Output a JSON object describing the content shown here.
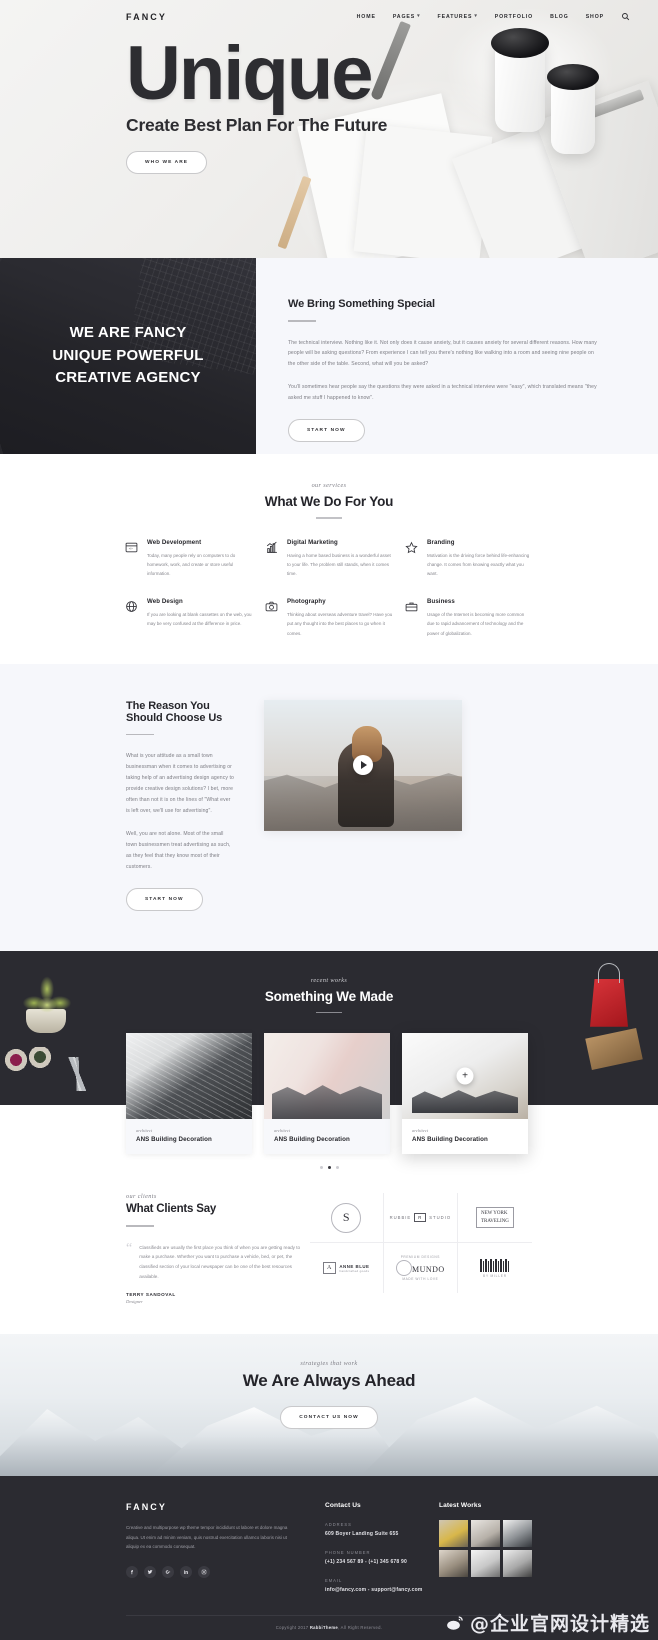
{
  "header": {
    "brand": "FANCY",
    "nav": [
      {
        "label": "HOME",
        "caret": false
      },
      {
        "label": "PAGES",
        "caret": true
      },
      {
        "label": "FEATURES",
        "caret": true
      },
      {
        "label": "PORTFOLIO",
        "caret": false
      },
      {
        "label": "BLOG",
        "caret": false
      },
      {
        "label": "SHOP",
        "caret": false
      }
    ],
    "search_icon": "search-icon"
  },
  "hero": {
    "title": "Unique",
    "subtitle": "Create Best Plan For The Future",
    "cta": "WHO WE ARE"
  },
  "about": {
    "left_heading": "WE ARE FANCY\nUNIQUE POWERFUL\nCREATIVE AGENCY",
    "title": "We Bring Something Special",
    "paragraph1": "The technical interview. Nothing like it. Not only does it cause anxiety, but it causes anxiety for several different reasons. How many people will be asking questions? From experience I can tell you there's nothing like walking into a room and seeing nine people on the other side of the table. Second, what will you be asked?",
    "paragraph2": "You'll sometimes hear people say the questions they were asked in a technical interview were \"easy\", which translated means \"they asked me stuff I happened to know\".",
    "cta": "START NOW"
  },
  "services": {
    "eyebrow": "our services",
    "title": "What We Do For You",
    "items": [
      {
        "icon": "browser-icon",
        "title": "Web Development",
        "text": "Today, many people rely on computers to do homework, work, and create or store useful information."
      },
      {
        "icon": "chart-bars-icon",
        "title": "Digital Marketing",
        "text": "Having a home based business is a wonderful asset to your life. The problem still stands, when it comes time."
      },
      {
        "icon": "star-icon",
        "title": "Branding",
        "text": "Motivation is the driving force behind life-enhancing change. It comes from knowing exactly what you want."
      },
      {
        "icon": "globe-icon",
        "title": "Web Design",
        "text": "If you are looking at blank cassettes on the web, you may be very confused at the difference in price."
      },
      {
        "icon": "camera-icon",
        "title": "Photography",
        "text": "Thinking about overseas adventure travel? Have you put any thought into the best places to go when it comes."
      },
      {
        "icon": "briefcase-icon",
        "title": "Business",
        "text": "Usage of the Internet is becoming more common due to rapid advancement of technology and the power of globalization."
      }
    ]
  },
  "choose": {
    "title": "The Reason You Should Choose Us",
    "paragraph1": "What is your attitude as a small town businessman when it comes to advertising or taking help of an advertising design agency to provide creative design solutions? I bet, more often than not it is on the lines of \"What ever is left over, we'll use for advertising\".",
    "paragraph2": "Well, you are not alone. Most of the small town businessmen treat advertising as such, as they feel that they know most of their customers.",
    "cta": "START NOW",
    "video_play": "play-icon"
  },
  "works": {
    "eyebrow": "recent works",
    "title": "Something We Made",
    "cards": [
      {
        "category": "architect",
        "title": "ANS Building Decoration"
      },
      {
        "category": "architect",
        "title": "ANS Building Decoration"
      },
      {
        "category": "architect",
        "title": "ANS Building Decoration"
      }
    ],
    "dots": [
      false,
      true,
      false
    ]
  },
  "clients": {
    "eyebrow": "our clients",
    "title": "What Clients Say",
    "quote": "Classifieds are usually the first place you think of when you are getting ready to make a purchase. Whether you want to purchase a vehicle, bed, or pet, the classified section of your local newspaper can be one of the best resources available.",
    "author": "TERRY SANDOVAL",
    "role": "Designer",
    "logos": [
      {
        "name": "seal-logo",
        "main": "S"
      },
      {
        "name": "studio-logo",
        "left": "RUBBIE",
        "mid": "R",
        "right": "STUDIO"
      },
      {
        "name": "new-york-traveling-logo",
        "line1": "NEW YORK",
        "line2": "TRAVELING"
      },
      {
        "name": "anne-blue-logo",
        "mark": "A",
        "main": "ANNE BLUE",
        "sub": "handcrafted goods"
      },
      {
        "name": "mundo-logo",
        "top": "PREMIUM DESIGNS",
        "main": "MUNDO",
        "sub": "MADE WITH LOVE"
      },
      {
        "name": "barcode-logo",
        "caption": "BY MILLER"
      }
    ]
  },
  "ahead": {
    "eyebrow": "strategies that work",
    "title": "We Are Always Ahead",
    "cta": "CONTACT US NOW"
  },
  "footer": {
    "brand": "FANCY",
    "about": "Creative and multipurpose wp theme tempor incididunt ut labore et dolore magna aliqua. Ut enim ad minim veniam, quis nostrud exercitation ullamco laboris nisi ut aliquip ex ea commodo consequat.",
    "socials": [
      "facebook-icon",
      "twitter-icon",
      "google-plus-icon",
      "linkedin-icon",
      "instagram-icon"
    ],
    "contact_heading": "Contact Us",
    "address_label": "ADDRESS",
    "address_value": "609 Boyer Landing Suite 655",
    "phone_label": "PHONE NUMBER",
    "phone_value": "(+1) 234 567 89 - (+1) 345 678 90",
    "email_label": "EMAIL",
    "email_value": "info@fancy.com - support@fancy.com",
    "works_heading": "Latest Works",
    "copyright_pre": "Copyright 2017 ",
    "copyright_brand": "RabbiTheme",
    "copyright_post": ", All Right Reserved."
  },
  "watermark": {
    "text": "@企业官网设计精选",
    "icon": "weibo-icon"
  },
  "colors": {
    "dark": "#2b2b31",
    "light_panel": "#f6f7fb",
    "text": "#2b2b2f",
    "muted": "#8a8a91",
    "accent_red": "#c8242b"
  }
}
